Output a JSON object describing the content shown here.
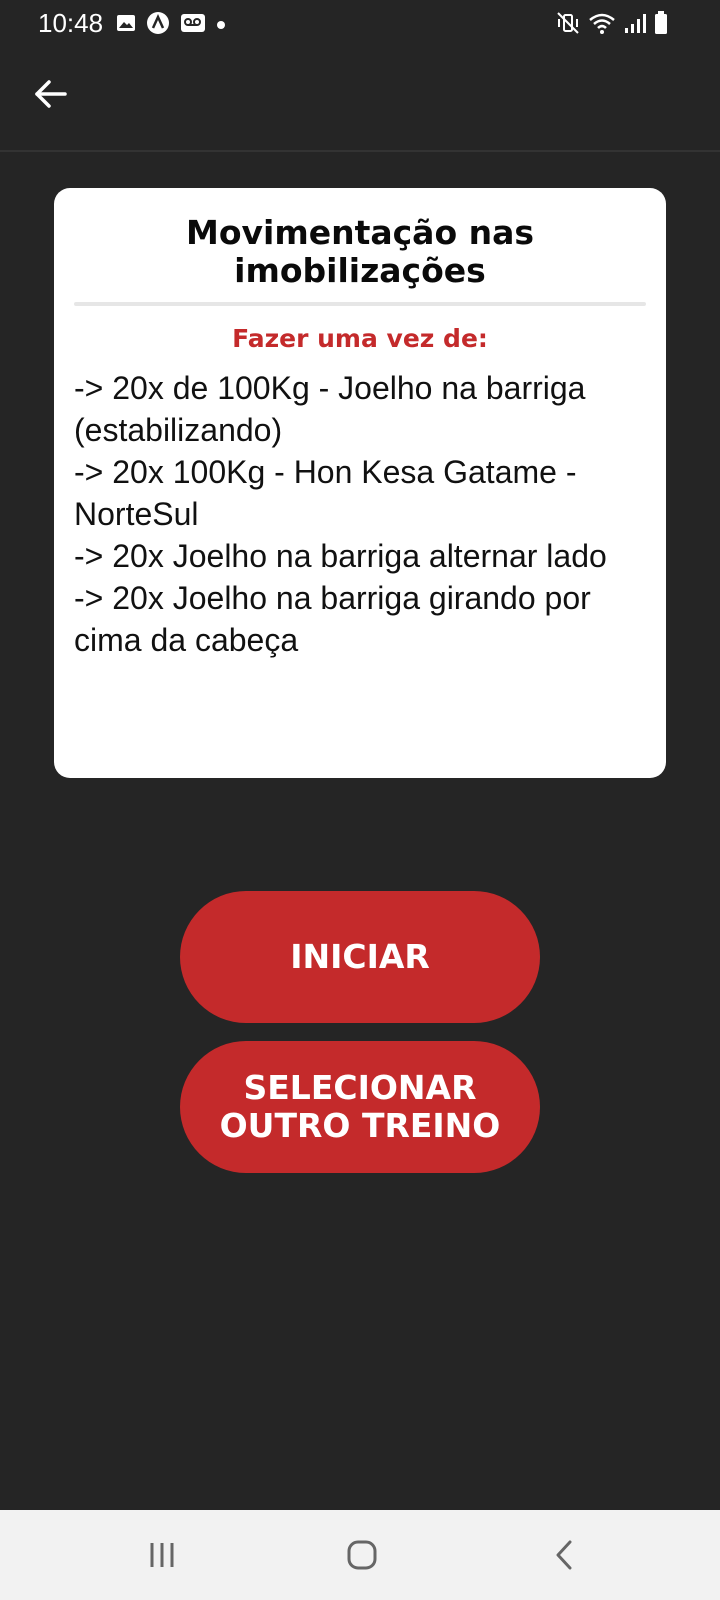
{
  "status_bar": {
    "time": "10:48",
    "left_icons": [
      "gallery-icon",
      "app-notification-icon",
      "voicemail-icon",
      "dot-icon"
    ],
    "right_icons": [
      "mute-vibrate-icon",
      "wifi-icon",
      "signal-icon",
      "battery-icon"
    ]
  },
  "app_bar": {
    "back_icon": "arrow-left-icon"
  },
  "card": {
    "title": "Movimentação nas imobilizações",
    "subtitle": "Fazer uma vez de:",
    "lines": [
      "-> 20x de 100Kg - Joelho na barriga (estabilizando)",
      "-> 20x 100Kg - Hon Kesa Gatame - NorteSul",
      "-> 20x Joelho na barriga alternar lado",
      "-> 20x Joelho na barriga girando por cima da cabeça"
    ]
  },
  "buttons": {
    "start_label": "INICIAR",
    "select_label": "SELECIONAR OUTRO TREINO"
  },
  "nav_bar": {
    "icons": [
      "recent-apps-icon",
      "home-icon",
      "back-chevron-icon"
    ]
  },
  "colors": {
    "background": "#252525",
    "accent": "#c42a2b",
    "card": "#ffffff",
    "nav_bar": "#f2f2f2"
  }
}
